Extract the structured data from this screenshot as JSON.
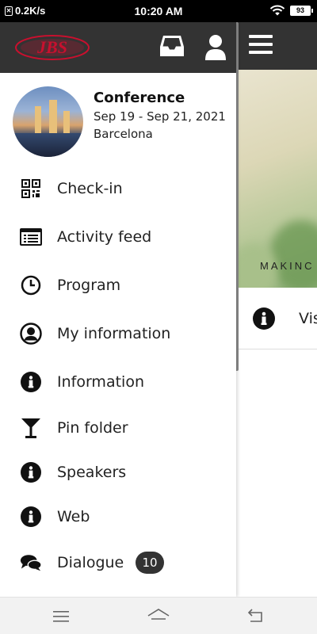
{
  "status_bar": {
    "network_speed": "0.2K/s",
    "time": "10:20 AM",
    "battery": "93"
  },
  "app": {
    "logo_text": "JBS",
    "brand_color": "#c8102e",
    "header_color": "#333333"
  },
  "event": {
    "name": "Conference",
    "dates": "Sep 19 - Sep 21, 2021",
    "city": "Barcelona"
  },
  "menu": {
    "items": [
      {
        "label": "Check-in",
        "icon": "qr-code-icon"
      },
      {
        "label": "Activity feed",
        "icon": "newspaper-icon"
      },
      {
        "label": "Program",
        "icon": "clock-icon"
      },
      {
        "label": "My information",
        "icon": "user-circle-icon"
      },
      {
        "label": "Information",
        "icon": "info-icon"
      },
      {
        "label": "Pin folder",
        "icon": "cocktail-glass-icon"
      },
      {
        "label": "Speakers",
        "icon": "info-icon"
      },
      {
        "label": "Web",
        "icon": "info-icon"
      },
      {
        "label": "Dialogue",
        "icon": "chat-bubbles-icon",
        "badge": "10"
      }
    ]
  },
  "background_page": {
    "banner_text": "MAKINC",
    "row_label": "Vis"
  }
}
